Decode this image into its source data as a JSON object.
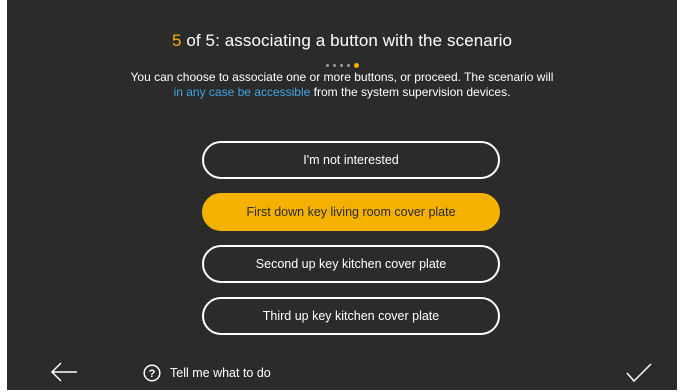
{
  "header": {
    "step_current": "5",
    "step_rest": " of 5: associating a button with the scenario"
  },
  "progress": {
    "total_steps": 5,
    "current_step": 5
  },
  "description": {
    "line1": "You can choose to associate one or more buttons, or proceed. The scenario will",
    "line2_link": "in any case be accessible",
    "line2_rest": " from the system supervision devices."
  },
  "options": [
    {
      "label": "I'm not interested",
      "selected": false
    },
    {
      "label": "First down key living room cover plate",
      "selected": true
    },
    {
      "label": "Second up key kitchen cover plate",
      "selected": false
    },
    {
      "label": "Third up key kitchen cover plate",
      "selected": false
    }
  ],
  "footer": {
    "back_icon": "arrow-left-icon",
    "help_icon": "question-circle-icon",
    "help_label": "Tell me what to do",
    "confirm_icon": "checkmark-icon"
  },
  "colors": {
    "background": "#2b2b2b",
    "accent": "#f5b100",
    "link": "#3fa6e0",
    "text": "#ffffff"
  }
}
